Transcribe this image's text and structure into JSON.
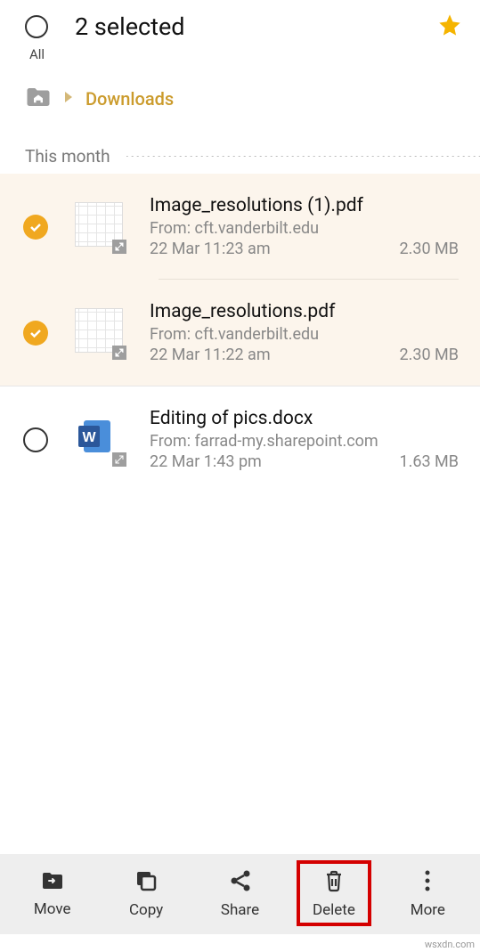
{
  "header": {
    "title": "2 selected",
    "all_label": "All",
    "star_icon": "star-icon"
  },
  "breadcrumb": {
    "current": "Downloads"
  },
  "section": {
    "label": "This month"
  },
  "files": [
    {
      "name": "Image_resolutions (1).pdf",
      "from": "From: cft.vanderbilt.edu",
      "date": "22 Mar 11:23 am",
      "size": "2.30 MB",
      "selected": true,
      "type": "pdf"
    },
    {
      "name": "Image_resolutions.pdf",
      "from": "From: cft.vanderbilt.edu",
      "date": "22 Mar 11:22 am",
      "size": "2.30 MB",
      "selected": true,
      "type": "pdf"
    },
    {
      "name": "Editing of pics.docx",
      "from": "From: farrad-my.sharepoint.com",
      "date": "22 Mar 1:43 pm",
      "size": "1.63 MB",
      "selected": false,
      "type": "docx"
    }
  ],
  "bottom_bar": {
    "move": "Move",
    "copy": "Copy",
    "share": "Share",
    "delete": "Delete",
    "more": "More"
  },
  "watermark": "wsxdn.com"
}
